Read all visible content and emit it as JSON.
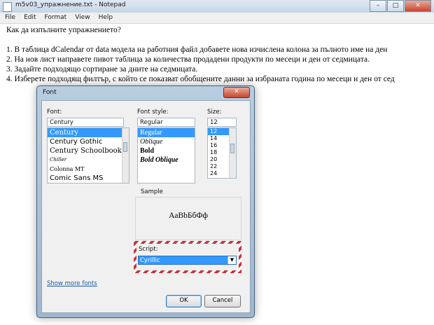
{
  "window": {
    "title": "m5v03_упражнение.txt - Notepad",
    "minimize": "–",
    "maximize": "□",
    "close": "✕"
  },
  "menu": [
    "File",
    "Edit",
    "Format",
    "View",
    "Help"
  ],
  "editor_lines": [
    "Как да изпълните упражнението?",
    "",
    "1. В таблица dCalendar от data модела на работния файл добавете нова изчислена колона за пълното име на ден",
    "2. На нов лист направете пивот таблица за количества продадени продукти по месеци и ден от седмицата.",
    "3. Задайте подходящо сортиране за дните на седмицата.",
    "4. Изберете подходящ филтър, с който се показват обобщените данни за избраната година по месеци и ден от сед"
  ],
  "font_dialog": {
    "title": "Font",
    "close": "✕",
    "font_label": "Font:",
    "font_value": "Century",
    "font_list": [
      "Century",
      "Century Gothic",
      "Century Schoolbook",
      "Chiller",
      "Colonna MT",
      "Comic Sans MS"
    ],
    "style_label": "Font style:",
    "style_value": "Regular",
    "style_list": [
      "Regular",
      "Oblique",
      "Bold",
      "Bold Oblique"
    ],
    "size_label": "Size:",
    "size_value": "12",
    "size_list": [
      "12",
      "14",
      "16",
      "18",
      "20",
      "22",
      "24"
    ],
    "sample_label": "Sample",
    "sample_text": "AaBbБбФф",
    "script_label": "Script:",
    "script_value": "Cyrillic",
    "show_more_fonts": "Show more fonts",
    "ok": "OK",
    "cancel": "Cancel"
  },
  "colors": {
    "selection": "#3399ff",
    "highlight_stripe": "#c9323c",
    "link": "#1a5aa8"
  }
}
